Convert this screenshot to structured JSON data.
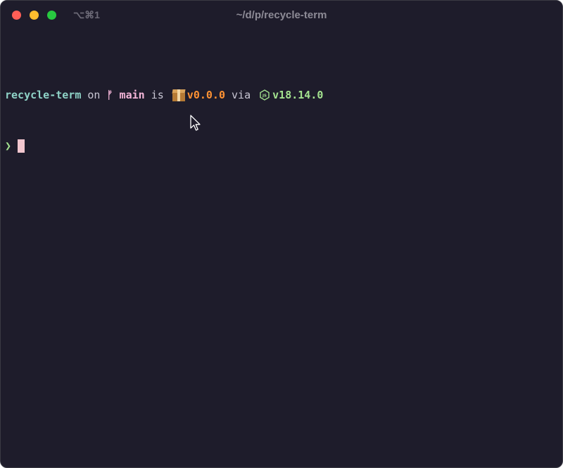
{
  "window": {
    "title": "~/d/p/recycle-term",
    "shortcut": "⌥⌘1"
  },
  "prompt": {
    "directory": "recycle-term",
    "on_word": "on",
    "branch_icon": "ᚠ",
    "branch": "main",
    "is_word": "is",
    "package_icon": "package-icon",
    "package_version": "v0.0.0",
    "via_word": "via",
    "node_icon": "nodejs-icon",
    "node_version": "v18.14.0",
    "prompt_char": "❯"
  },
  "colors": {
    "background": "#1e1c2b",
    "directory": "#8fd3c7",
    "branch": "#f4b6d9",
    "package_version": "#ff9233",
    "node_version": "#a3e28f",
    "cursor": "#f2c6cf"
  }
}
